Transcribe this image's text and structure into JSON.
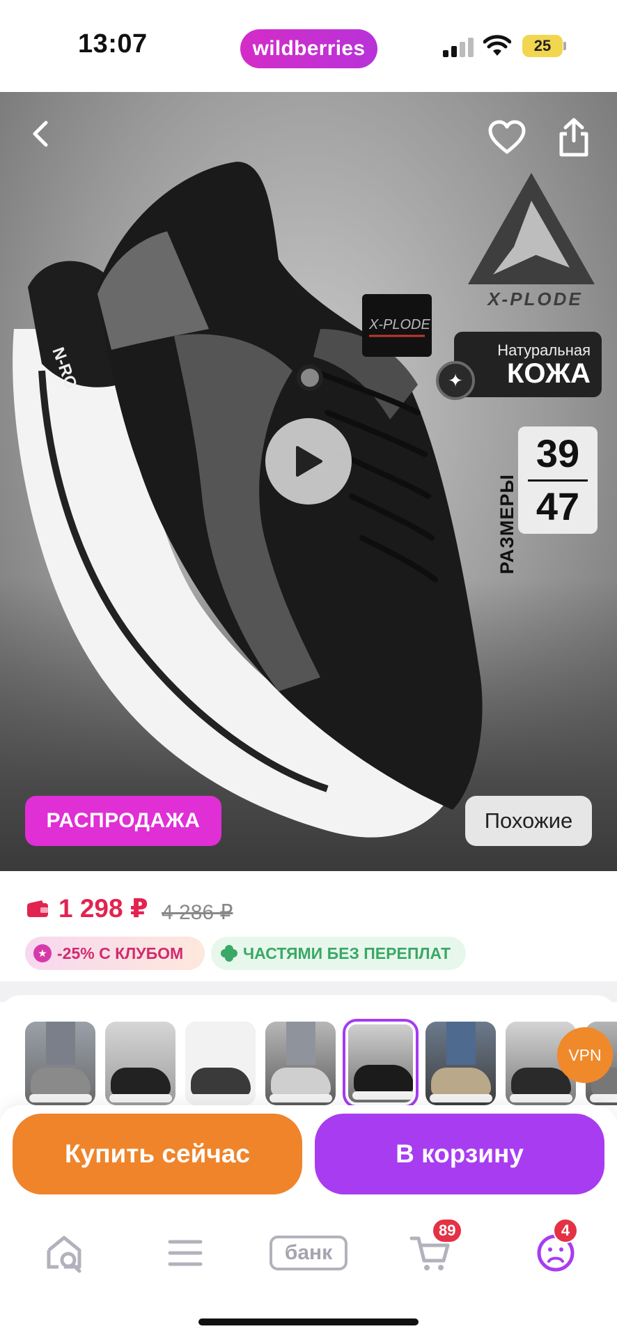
{
  "status_bar": {
    "time": "13:07",
    "app_brand": "wildberries",
    "battery": "25"
  },
  "hero": {
    "brand_logo_text": "X-PLODE",
    "leather_badge": {
      "small": "Натуральная",
      "big": "КОЖА"
    },
    "sizes": {
      "label": "РАЗМЕРЫ",
      "from": "39",
      "to": "47"
    },
    "sale_label": "РАСПРОДАЖА",
    "similar_label": "Похожие",
    "icons": [
      "back-arrow-icon",
      "heart-icon",
      "share-icon",
      "play-icon"
    ]
  },
  "price": {
    "current": "1 298 ₽",
    "old": "4 286 ₽",
    "club_badge": "-25% С КЛУБОМ",
    "installments_badge": "ЧАСТЯМИ БЕЗ ПЕРЕПЛАТ"
  },
  "thumbnails": {
    "count": 9,
    "selected_index": 4
  },
  "vpn_label": "VPN",
  "actions": {
    "buy_now": "Купить сейчас",
    "add_to_cart": "В корзину"
  },
  "tab_bar": {
    "home_icon": "home-search-icon",
    "catalog_icon": "menu-icon",
    "bank_label": "банк",
    "cart_badge": "89",
    "profile_badge": "4"
  },
  "colors": {
    "brand_pill": "#d42cc7",
    "sale": "#df2fd5",
    "price": "#e3234f",
    "buy_now": "#ef842b",
    "to_cart": "#a83cf0",
    "installments": "#3aa866"
  }
}
